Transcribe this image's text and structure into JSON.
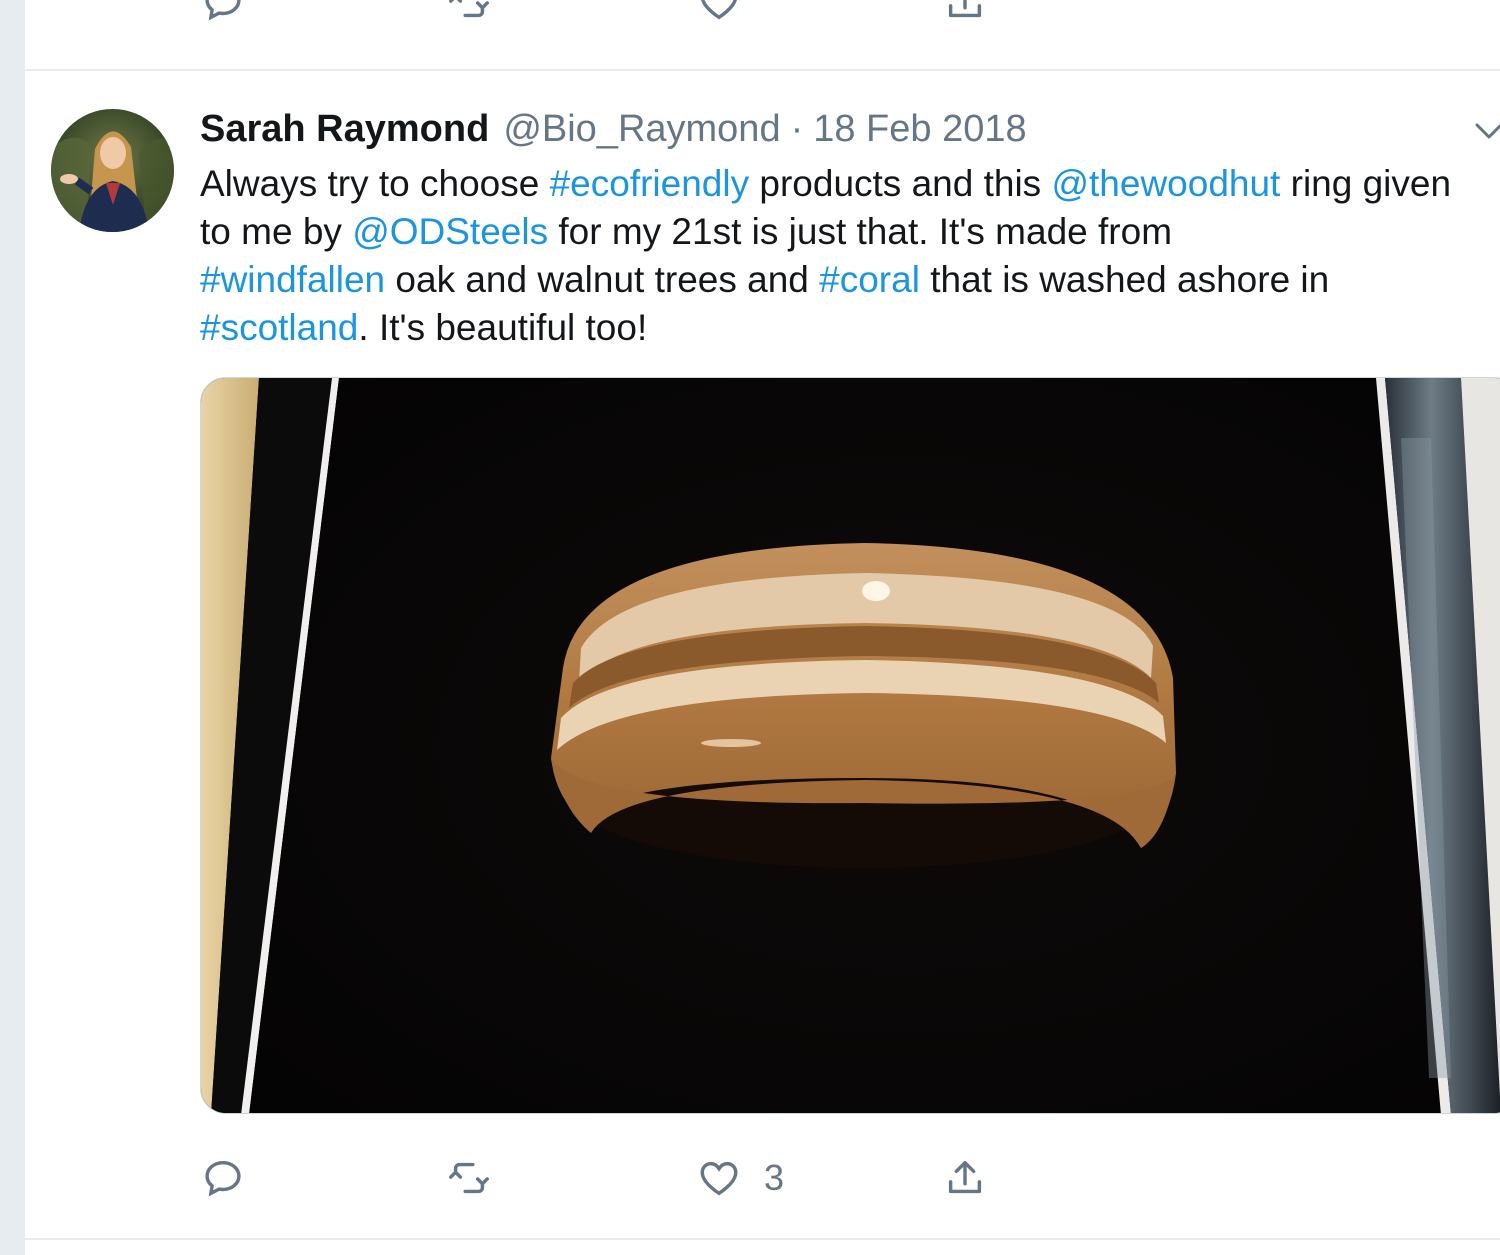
{
  "prev_tweet": {
    "actions": {
      "reply_icon": "reply-icon",
      "retweet_icon": "retweet-icon",
      "like_icon": "heart-icon",
      "share_icon": "share-icon"
    }
  },
  "tweet": {
    "author_name": "Sarah Raymond",
    "handle": "@Bio_Raymond",
    "separator": "·",
    "date": "18 Feb 2018",
    "text": {
      "t1": "Always try to choose ",
      "h1": "#ecofriendly",
      "t2": " products and this ",
      "m1": "@thewoodhut",
      "t3": " ring given to me by ",
      "m2": "@ODSteels",
      "t4": " for my 21st is just that. It's made from ",
      "h2": "#windfallen",
      "t5": " oak and walnut trees and ",
      "h3": "#coral",
      "t6": " that is washed ashore in ",
      "h4": "#scotland",
      "t7": ". It's beautiful too!"
    },
    "actions": {
      "reply_icon": "reply-icon",
      "retweet_icon": "retweet-icon",
      "like_icon": "heart-icon",
      "like_count": "3",
      "share_icon": "share-icon"
    }
  },
  "colors": {
    "link": "#1b95e0",
    "secondary_text": "#657786",
    "border": "#e6ecf0"
  }
}
